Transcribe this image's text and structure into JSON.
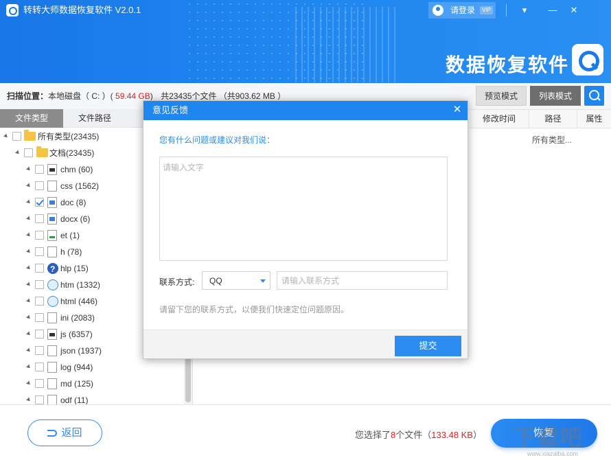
{
  "header": {
    "app_title": "转转大师数据恢复软件 V2.0.1",
    "login_label": "请登录",
    "vip_badge": "VIP",
    "brand_text": "数据恢复软件",
    "window_buttons": [
      "menu-icon",
      "minimize-icon",
      "close-icon"
    ]
  },
  "infobar": {
    "scan_label": "扫描位置：",
    "scan_location": "本地磁盘（ C: ）(",
    "disk_size": "59.44 GB",
    "disk_tail": ")",
    "file_count_text": "共23435个文件 （共903.62 MB ）",
    "preview_mode": "预览模式",
    "list_mode": "列表模式"
  },
  "tabs": {
    "file_type": "文件类型",
    "file_path": "文件路径"
  },
  "tree": {
    "root": "所有类型(23435)",
    "docs": "文档(23435)",
    "items": [
      {
        "label": "chm (60)",
        "icon": "chm",
        "checked": false
      },
      {
        "label": "css (1562)",
        "icon": "css",
        "checked": false
      },
      {
        "label": "doc (8)",
        "icon": "doc",
        "checked": true
      },
      {
        "label": "docx (6)",
        "icon": "docx",
        "checked": false
      },
      {
        "label": "et (1)",
        "icon": "et",
        "checked": false
      },
      {
        "label": "h (78)",
        "icon": "h",
        "checked": false
      },
      {
        "label": "hlp (15)",
        "icon": "help",
        "checked": false
      },
      {
        "label": "htm (1332)",
        "icon": "web",
        "checked": false
      },
      {
        "label": "html (446)",
        "icon": "web",
        "checked": false
      },
      {
        "label": "ini (2083)",
        "icon": "ini",
        "checked": false
      },
      {
        "label": "js (6357)",
        "icon": "js",
        "checked": false
      },
      {
        "label": "json (1937)",
        "icon": "json",
        "checked": false
      },
      {
        "label": "log (944)",
        "icon": "log",
        "checked": false
      },
      {
        "label": "md (125)",
        "icon": "md",
        "checked": false
      },
      {
        "label": "odf (11)",
        "icon": "odf",
        "checked": false
      }
    ]
  },
  "columns": {
    "modified": "修改时间",
    "path": "路径",
    "attr": "属性",
    "path_value": "所有类型..."
  },
  "bottom": {
    "back_label": "返回",
    "sel_prefix": "您选择了",
    "sel_count": "8",
    "sel_mid": "个文件（",
    "sel_size": "133.48 KB",
    "sel_suffix": "）",
    "recover_label": "恢复",
    "watermark": "下载吧",
    "watermark_sub": "www.xiazaiba.com"
  },
  "dialog": {
    "title": "意见反馈",
    "question": "您有什么问题或建议对我们说：",
    "text_placeholder": "请输入文字",
    "contact_label": "联系方式:",
    "contact_type": "QQ",
    "contact_placeholder": "请输入联系方式",
    "hint": "请留下您的联系方式，以便我们快速定位问题原因。",
    "submit_label": "提交"
  },
  "colors": {
    "accent": "#1f86f0",
    "highlight_red": "#e02020"
  }
}
